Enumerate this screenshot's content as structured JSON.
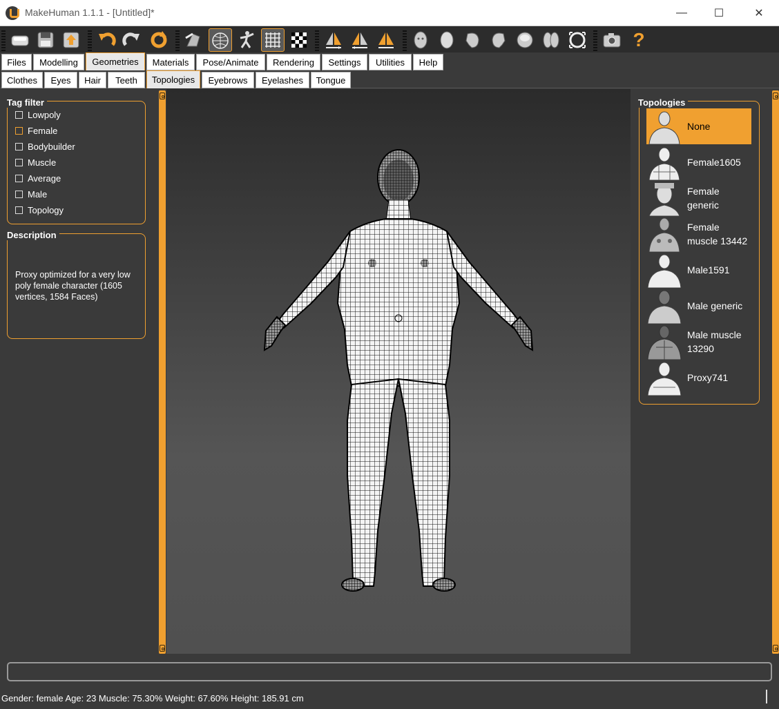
{
  "window": {
    "title": "MakeHuman 1.1.1 - [Untitled]*",
    "minimize_glyph": "—",
    "maximize_glyph": "☐",
    "close_glyph": "✕"
  },
  "toolbar": {
    "buttons": [
      {
        "icon": "load-icon"
      },
      {
        "icon": "save-icon"
      },
      {
        "icon": "export-icon"
      },
      {
        "icon": "undo-icon"
      },
      {
        "icon": "redo-icon"
      },
      {
        "icon": "reset-icon"
      },
      {
        "icon": "smooth-icon"
      },
      {
        "icon": "wireframe-icon"
      },
      {
        "icon": "pose-icon"
      },
      {
        "icon": "grid-icon"
      },
      {
        "icon": "checker-icon"
      },
      {
        "icon": "symmetry-right-icon"
      },
      {
        "icon": "symmetry-left-icon"
      },
      {
        "icon": "symmetry-icon"
      },
      {
        "icon": "front-view-icon"
      },
      {
        "icon": "back-view-icon"
      },
      {
        "icon": "left-view-icon"
      },
      {
        "icon": "right-view-icon"
      },
      {
        "icon": "top-view-icon"
      },
      {
        "icon": "bottom-view-icon"
      },
      {
        "icon": "reset-camera-icon"
      },
      {
        "icon": "screenshot-icon"
      },
      {
        "icon": "help-icon"
      }
    ],
    "help_glyph": "?"
  },
  "main_tabs": [
    "Files",
    "Modelling",
    "Geometries",
    "Materials",
    "Pose/Animate",
    "Rendering",
    "Settings",
    "Utilities",
    "Help"
  ],
  "main_tab_active": "Geometries",
  "sub_tabs": [
    "Clothes",
    "Eyes",
    "Hair",
    "Teeth",
    "Topologies",
    "Eyebrows",
    "Eyelashes",
    "Tongue"
  ],
  "sub_tab_active": "Topologies",
  "tag_filter": {
    "title": "Tag filter",
    "tags": [
      "Lowpoly",
      "Female",
      "Bodybuilder",
      "Muscle",
      "Average",
      "Male",
      "Topology"
    ]
  },
  "description": {
    "title": "Description",
    "text": "Proxy optimized for a very low poly female character (1605 vertices, 1584 Faces)"
  },
  "topologies": {
    "title": "Topologies",
    "selected": "None",
    "items": [
      "None",
      "Female1605",
      "Female generic",
      "Female muscle 13442",
      "Male1591",
      "Male generic",
      "Male muscle 13290",
      "Proxy741"
    ]
  },
  "status": "Gender: female Age: 23 Muscle: 75.30% Weight: 67.60% Height: 185.91 cm",
  "colors": {
    "accent": "#f0a030",
    "background": "#3a3a3a",
    "toolbar": "#2c2c2c"
  }
}
